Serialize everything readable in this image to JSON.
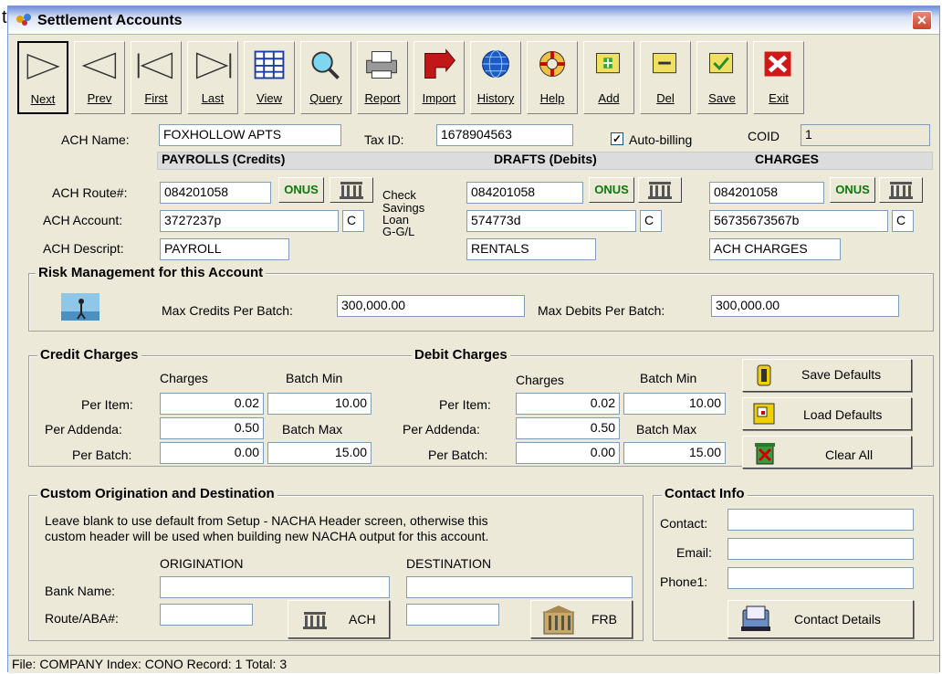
{
  "window": {
    "title": "Settlement Accounts",
    "stray_text": "t"
  },
  "toolbar": [
    {
      "label": "Next",
      "icon": "next-arrow-icon"
    },
    {
      "label": "Prev",
      "icon": "prev-arrow-icon"
    },
    {
      "label": "First",
      "icon": "first-arrow-icon"
    },
    {
      "label": "Last",
      "icon": "last-arrow-icon"
    },
    {
      "label": "View",
      "icon": "grid-icon"
    },
    {
      "label": "Query",
      "icon": "magnifier-icon"
    },
    {
      "label": "Report",
      "icon": "printer-icon"
    },
    {
      "label": "Import",
      "icon": "import-arrow-icon"
    },
    {
      "label": "History",
      "icon": "globe-icon"
    },
    {
      "label": "Help",
      "icon": "lifebuoy-icon"
    },
    {
      "label": "Add",
      "icon": "add-folder-icon"
    },
    {
      "label": "Del",
      "icon": "delete-folder-icon"
    },
    {
      "label": "Save",
      "icon": "save-folder-icon"
    },
    {
      "label": "Exit",
      "icon": "exit-x-icon"
    }
  ],
  "header": {
    "ach_name_label": "ACH Name:",
    "ach_name": "FOXHOLLOW APTS",
    "tax_id_label": "Tax ID:",
    "tax_id": "1678904563",
    "auto_billing_label": "Auto-billing",
    "auto_billing_checked": true,
    "coid_label": "COID",
    "coid": "1"
  },
  "columns": {
    "payrolls": "PAYROLLS (Credits)",
    "drafts": "DRAFTS (Debits)",
    "charges": "CHARGES"
  },
  "ach_labels": {
    "route": "ACH Route#:",
    "account": "ACH Account:",
    "descript": "ACH Descript:"
  },
  "account_types": [
    "Check",
    "Savings",
    "Loan",
    "G-G/L"
  ],
  "onus_label": "ONUS",
  "payrolls": {
    "route": "084201058",
    "account": "3727237p",
    "type": "C",
    "descript": "PAYROLL"
  },
  "drafts": {
    "route": "084201058",
    "account": "574773d",
    "type": "C",
    "descript": "RENTALS"
  },
  "charges": {
    "route": "084201058",
    "account": "56735673567b",
    "type": "C",
    "descript": "ACH CHARGES"
  },
  "risk": {
    "title": "Risk Management for this Account",
    "max_credits_label": "Max Credits Per Batch:",
    "max_credits": "300,000.00",
    "max_debits_label": "Max Debits Per Batch:",
    "max_debits": "300,000.00"
  },
  "credit_charges": {
    "title": "Credit Charges",
    "charges_hdr": "Charges",
    "batch_min_hdr": "Batch Min",
    "batch_max_hdr": "Batch Max",
    "per_item_label": "Per Item:",
    "per_addenda_label": "Per Addenda:",
    "per_batch_label": "Per Batch:",
    "per_item": "0.02",
    "per_addenda": "0.50",
    "per_batch": "0.00",
    "batch_min": "10.00",
    "batch_max": "15.00"
  },
  "debit_charges": {
    "title": "Debit Charges",
    "charges_hdr": "Charges",
    "batch_min_hdr": "Batch Min",
    "batch_max_hdr": "Batch Max",
    "per_item_label": "Per Item:",
    "per_addenda_label": "Per Addenda:",
    "per_batch_label": "Per Batch:",
    "per_item": "0.02",
    "per_addenda": "0.50",
    "per_batch": "0.00",
    "batch_min": "10.00",
    "batch_max": "15.00"
  },
  "defaults_buttons": {
    "save": "Save Defaults",
    "load": "Load Defaults",
    "clear": "Clear All"
  },
  "custom": {
    "title": "Custom Origination and Destination",
    "note_line1": "Leave blank to use default from Setup - NACHA Header screen, otherwise this",
    "note_line2": "custom header will be used when building new NACHA output for this account.",
    "origination": "ORIGINATION",
    "destination": "DESTINATION",
    "bank_name_label": "Bank Name:",
    "route_label": "Route/ABA#:",
    "ach_button": "ACH",
    "frb_button": "FRB",
    "orig_bank_name": "",
    "orig_route": "",
    "dest_bank_name": "",
    "dest_route": ""
  },
  "contact": {
    "title": "Contact Info",
    "contact_label": "Contact:",
    "email_label": "Email:",
    "phone_label": "Phone1:",
    "contact": "",
    "email": "",
    "phone": "",
    "details_button": "Contact Details"
  },
  "status": "File: COMPANY  Index: CONO  Record: 1  Total: 3"
}
